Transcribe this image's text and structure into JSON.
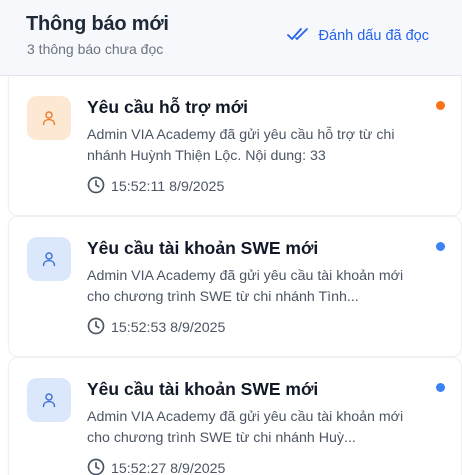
{
  "header": {
    "title": "Thông báo mới",
    "subtitle": "3 thông báo chưa đọc",
    "mark_all_read": "Đánh dấu đã đọc"
  },
  "notifications": [
    {
      "title": "Yêu cầu hỗ trợ mới",
      "body": "Admin VIA Academy đã gửi yêu cầu hỗ trợ từ chi nhánh Huỳnh Thiện Lộc. Nội dung: 33",
      "time": "15:52:11 8/9/2025",
      "icon": "user-icon",
      "avatar_bg": "#fde8d3",
      "icon_color": "#ea7a2a",
      "dot_color": "#f97316"
    },
    {
      "title": "Yêu cầu tài khoản SWE mới",
      "body": "Admin VIA Academy đã gửi yêu cầu tài khoản mới cho chương trình SWE từ chi nhánh Tình...",
      "time": "15:52:53 8/9/2025",
      "icon": "user-icon",
      "avatar_bg": "#dbe7fb",
      "icon_color": "#3b6fd8",
      "dot_color": "#3b82f6"
    },
    {
      "title": "Yêu cầu tài khoản SWE mới",
      "body": "Admin VIA Academy đã gửi yêu cầu tài khoản mới cho chương trình SWE từ chi nhánh Huỳ...",
      "time": "15:52:27 8/9/2025",
      "icon": "user-icon",
      "avatar_bg": "#dbe7fb",
      "icon_color": "#3b6fd8",
      "dot_color": "#3b82f6"
    }
  ]
}
